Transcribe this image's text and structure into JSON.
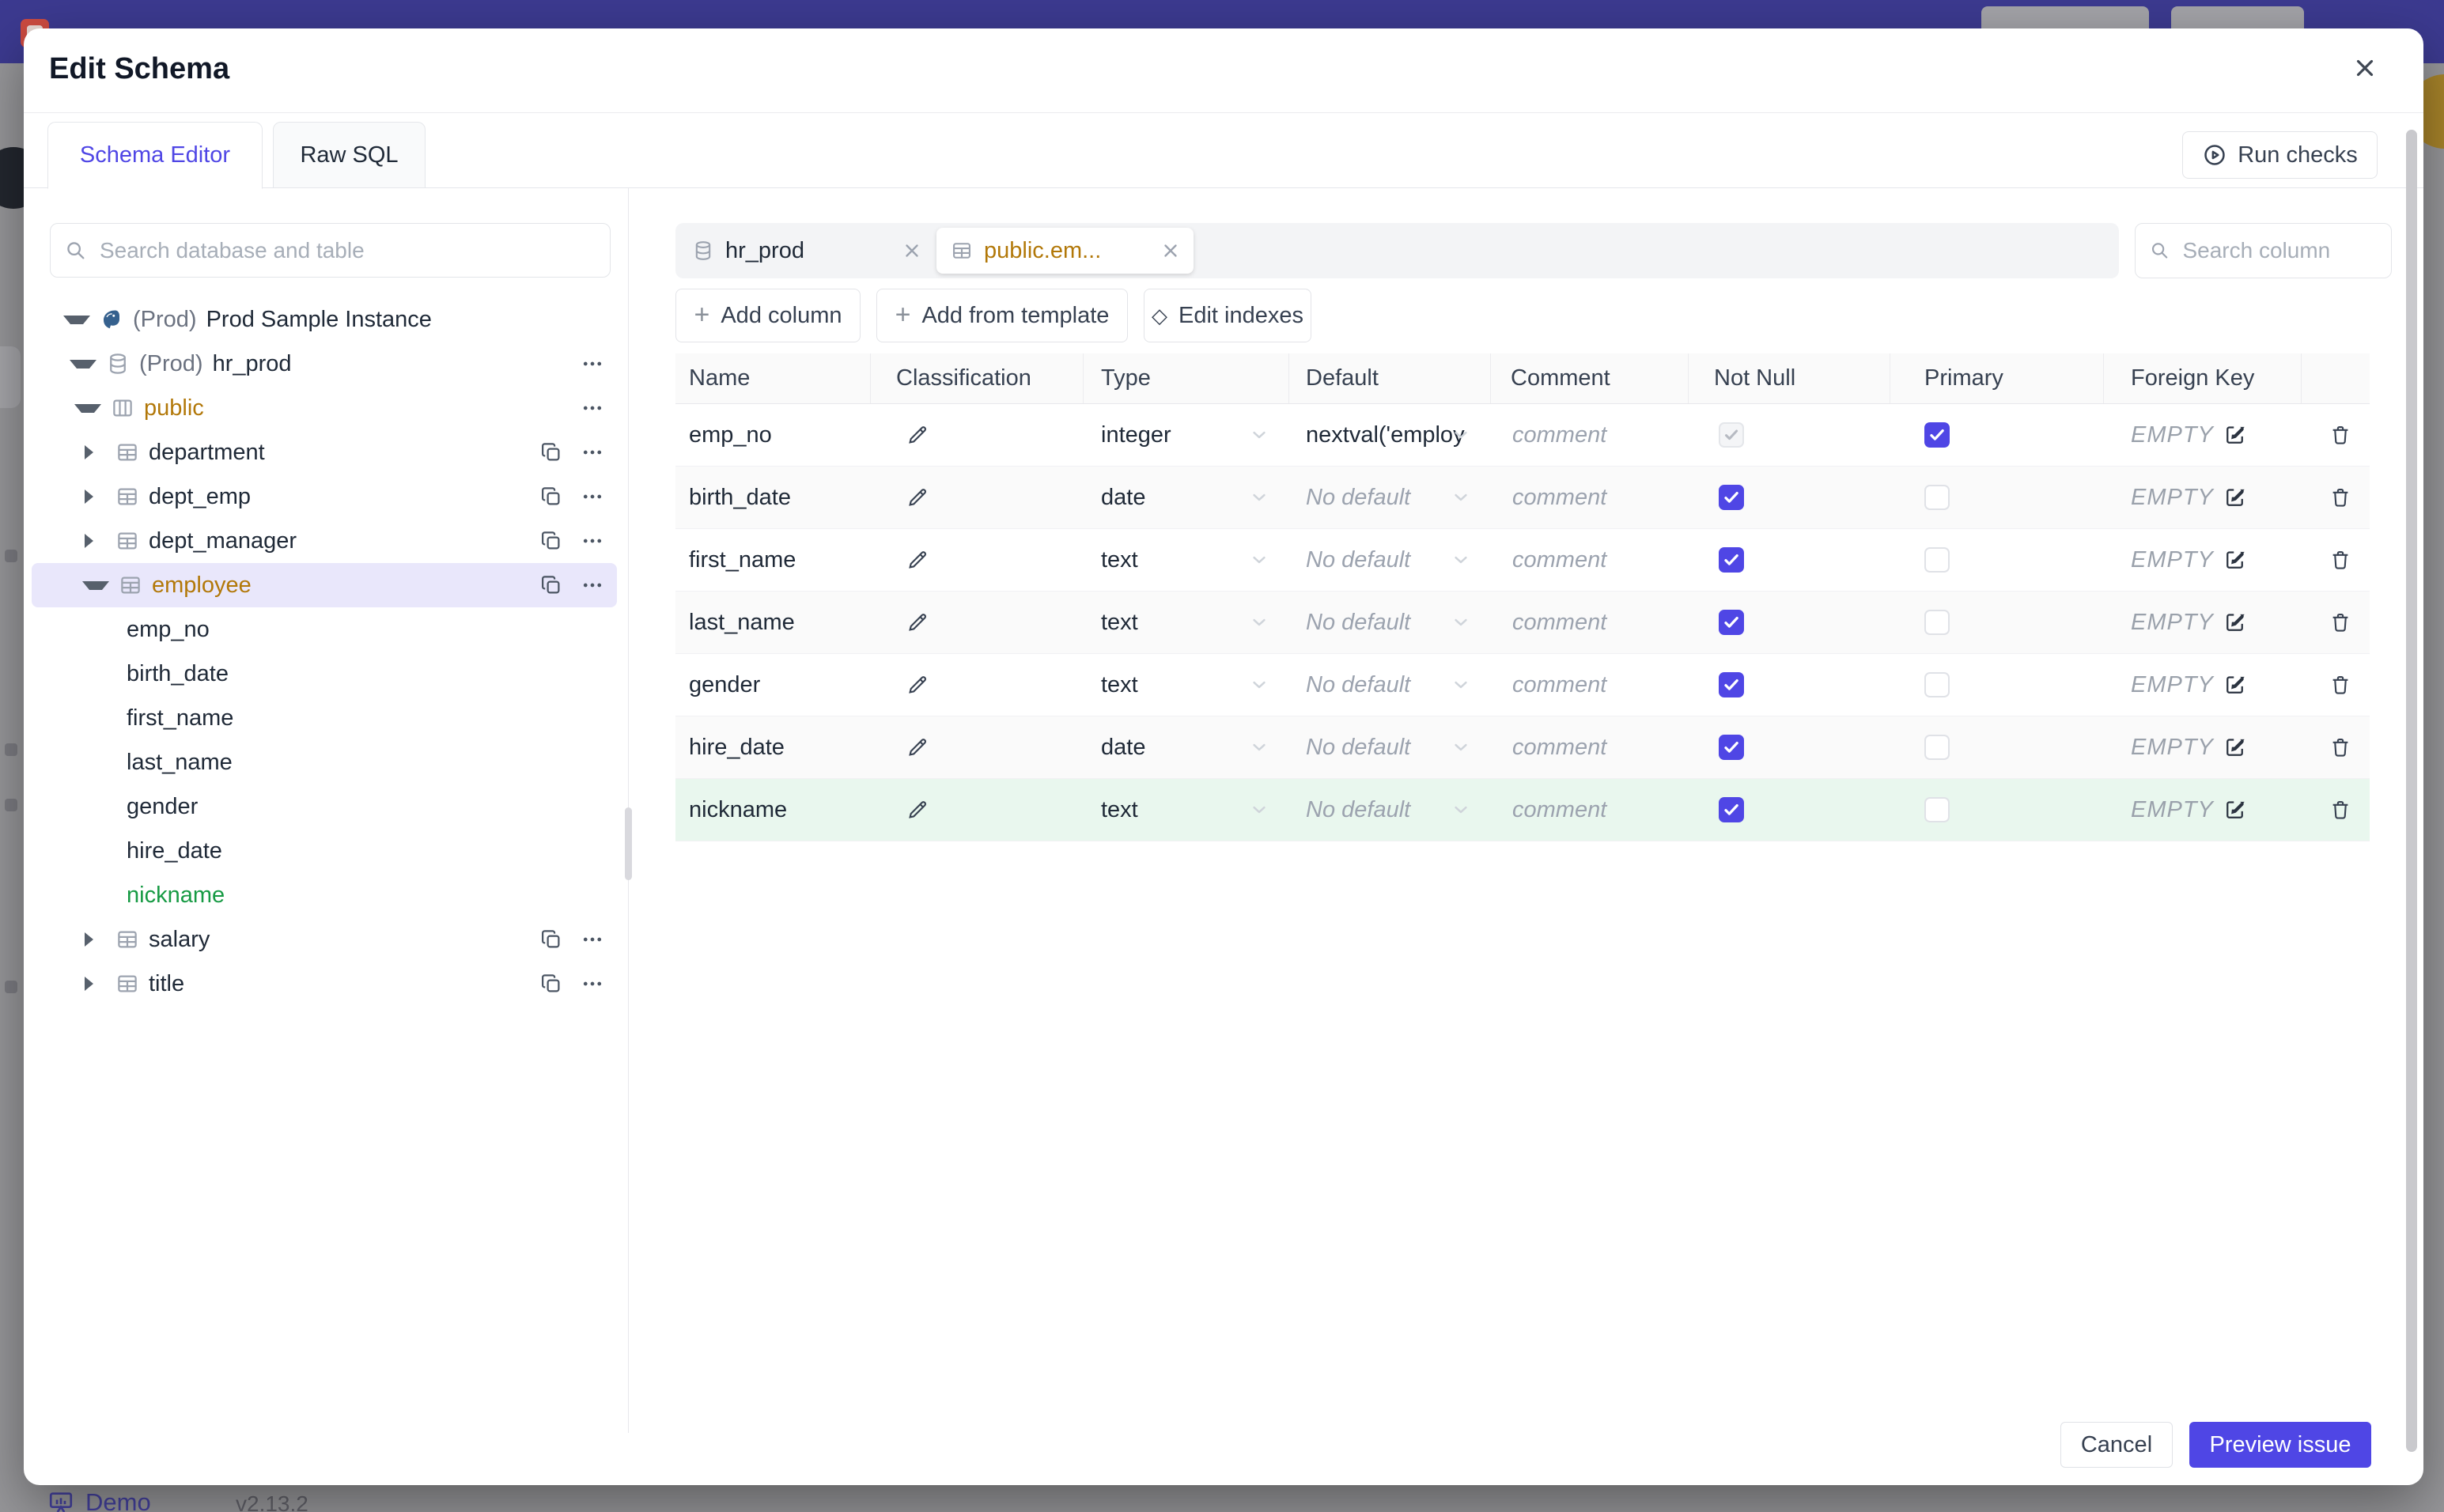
{
  "colors": {
    "accent": "#4f46e5",
    "topbar": "#3c3a90",
    "selected_tree_bg": "#e9e7fb",
    "table_name_amber": "#b27809",
    "new_item_green": "#169a43",
    "new_row_bg": "#e9f7ee"
  },
  "backdrop": {
    "demo": "Demo",
    "version": "v2.13.2"
  },
  "modal": {
    "title": "Edit Schema"
  },
  "header_tabs": [
    {
      "label": "Schema Editor"
    },
    {
      "label": "Raw SQL"
    }
  ],
  "run_checks": "Run checks",
  "sidebar": {
    "search_placeholder": "Search database and table",
    "tree": [
      {
        "prefix": "(Prod)",
        "label": "Prod Sample Instance"
      },
      {
        "prefix": "(Prod)",
        "label": "hr_prod"
      },
      {
        "label": "public"
      },
      {
        "label": "department"
      },
      {
        "label": "dept_emp"
      },
      {
        "label": "dept_manager"
      },
      {
        "label": "employee"
      },
      {
        "label": "emp_no"
      },
      {
        "label": "birth_date"
      },
      {
        "label": "first_name"
      },
      {
        "label": "last_name"
      },
      {
        "label": "gender"
      },
      {
        "label": "hire_date"
      },
      {
        "label": "nickname"
      },
      {
        "label": "salary"
      },
      {
        "label": "title"
      }
    ]
  },
  "editor": {
    "tabs": [
      {
        "label": "hr_prod"
      },
      {
        "label": "public.em..."
      }
    ],
    "search_placeholder": "Search column",
    "toolbar": {
      "add_column": "Add column",
      "add_from_template": "Add from template",
      "edit_indexes": "Edit indexes"
    },
    "table": {
      "headers": [
        "Name",
        "Classification",
        "Type",
        "Default",
        "Comment",
        "Not Null",
        "Primary",
        "Foreign Key"
      ],
      "comment_placeholder": "comment",
      "fk_empty": "EMPTY",
      "rows": [
        {
          "name": "emp_no",
          "type": "integer",
          "default": "nextval('employ",
          "not_null": "checked_disabled",
          "primary": true,
          "is_new": false
        },
        {
          "name": "birth_date",
          "type": "date",
          "default": "No default",
          "not_null": true,
          "primary": false,
          "is_new": false
        },
        {
          "name": "first_name",
          "type": "text",
          "default": "No default",
          "not_null": true,
          "primary": false,
          "is_new": false
        },
        {
          "name": "last_name",
          "type": "text",
          "default": "No default",
          "not_null": true,
          "primary": false,
          "is_new": false
        },
        {
          "name": "gender",
          "type": "text",
          "default": "No default",
          "not_null": true,
          "primary": false,
          "is_new": false
        },
        {
          "name": "hire_date",
          "type": "date",
          "default": "No default",
          "not_null": true,
          "primary": false,
          "is_new": false
        },
        {
          "name": "nickname",
          "type": "text",
          "default": "No default",
          "not_null": true,
          "primary": false,
          "is_new": true
        }
      ]
    }
  },
  "footer": {
    "cancel": "Cancel",
    "preview": "Preview issue"
  }
}
